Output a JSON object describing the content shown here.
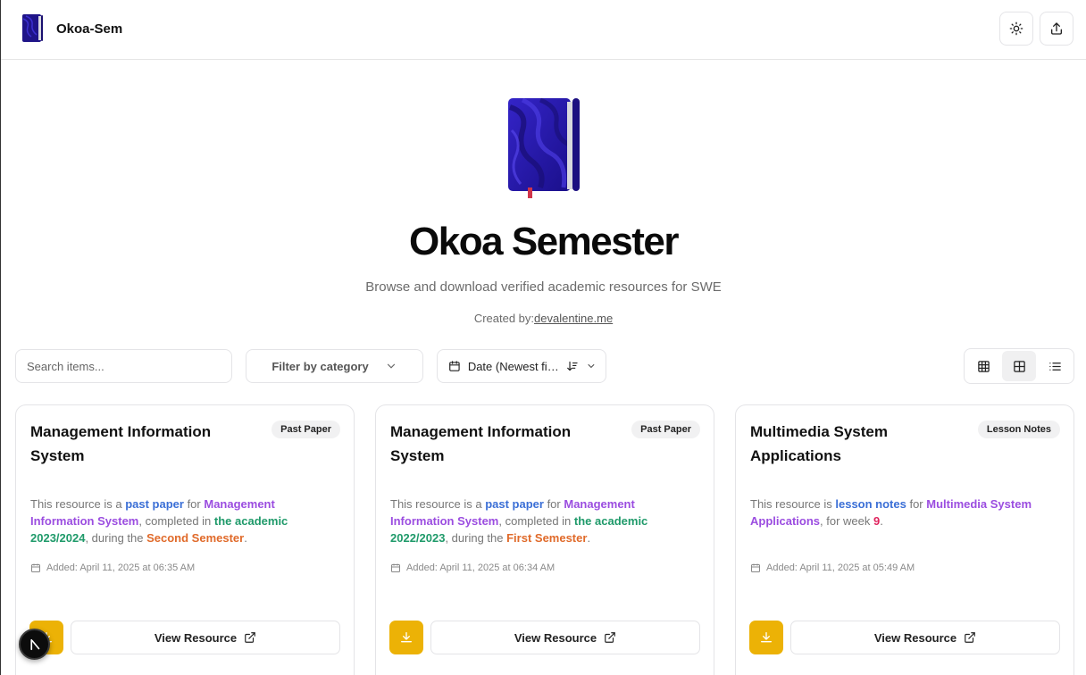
{
  "header": {
    "brand_title": "Okoa-Sem",
    "theme_icon": "sun-icon",
    "share_icon": "share-upload-icon"
  },
  "hero": {
    "title": "Okoa Semester",
    "subtitle": "Browse and download verified academic resources for SWE",
    "credit_prefix": "Created by:",
    "credit_link": "devalentine.me"
  },
  "toolbar": {
    "search_placeholder": "Search items...",
    "filter_label": "Filter by category",
    "sort_label": "Date (Newest first)",
    "views": [
      {
        "icon": "grid-3-icon",
        "active": false
      },
      {
        "icon": "grid-2-icon",
        "active": true
      },
      {
        "icon": "list-icon",
        "active": false
      }
    ]
  },
  "cards": [
    {
      "title": "Management Information System",
      "badge": "Past Paper",
      "desc": {
        "p1": "This resource is a ",
        "type": "past paper",
        "p2": " for ",
        "course": "Management Information System",
        "p3": ", completed in ",
        "year": "the academic 2023/2024",
        "p4": ", during the ",
        "semester": "Second Semester",
        "p5": "."
      },
      "added": "Added: April 11, 2025 at 06:35 AM",
      "view_label": "View Resource"
    },
    {
      "title": "Management Information System",
      "badge": "Past Paper",
      "desc": {
        "p1": "This resource is a ",
        "type": "past paper",
        "p2": " for ",
        "course": "Management Information System",
        "p3": ", completed in ",
        "year": "the academic 2022/2023",
        "p4": ", during the ",
        "semester": "First Semester",
        "p5": "."
      },
      "added": "Added: April 11, 2025 at 06:34 AM",
      "view_label": "View Resource"
    },
    {
      "title": "Multimedia System Applications",
      "badge": "Lesson Notes",
      "desc": {
        "p1": "This resource is ",
        "type": "lesson notes",
        "p2": " for ",
        "course": "Multimedia System Applications",
        "p3": ", for week ",
        "week": "9",
        "p4": "."
      },
      "added": "Added: April 11, 2025 at 05:49 AM",
      "view_label": "View Resource"
    }
  ],
  "colors": {
    "accent_yellow": "#ecb206",
    "book_blue": "#2a1aa0",
    "link_blue": "#3b6fd6",
    "purple": "#9b4de0",
    "green": "#1f9a6a",
    "orange": "#e06a2a",
    "pink": "#e0245e"
  }
}
